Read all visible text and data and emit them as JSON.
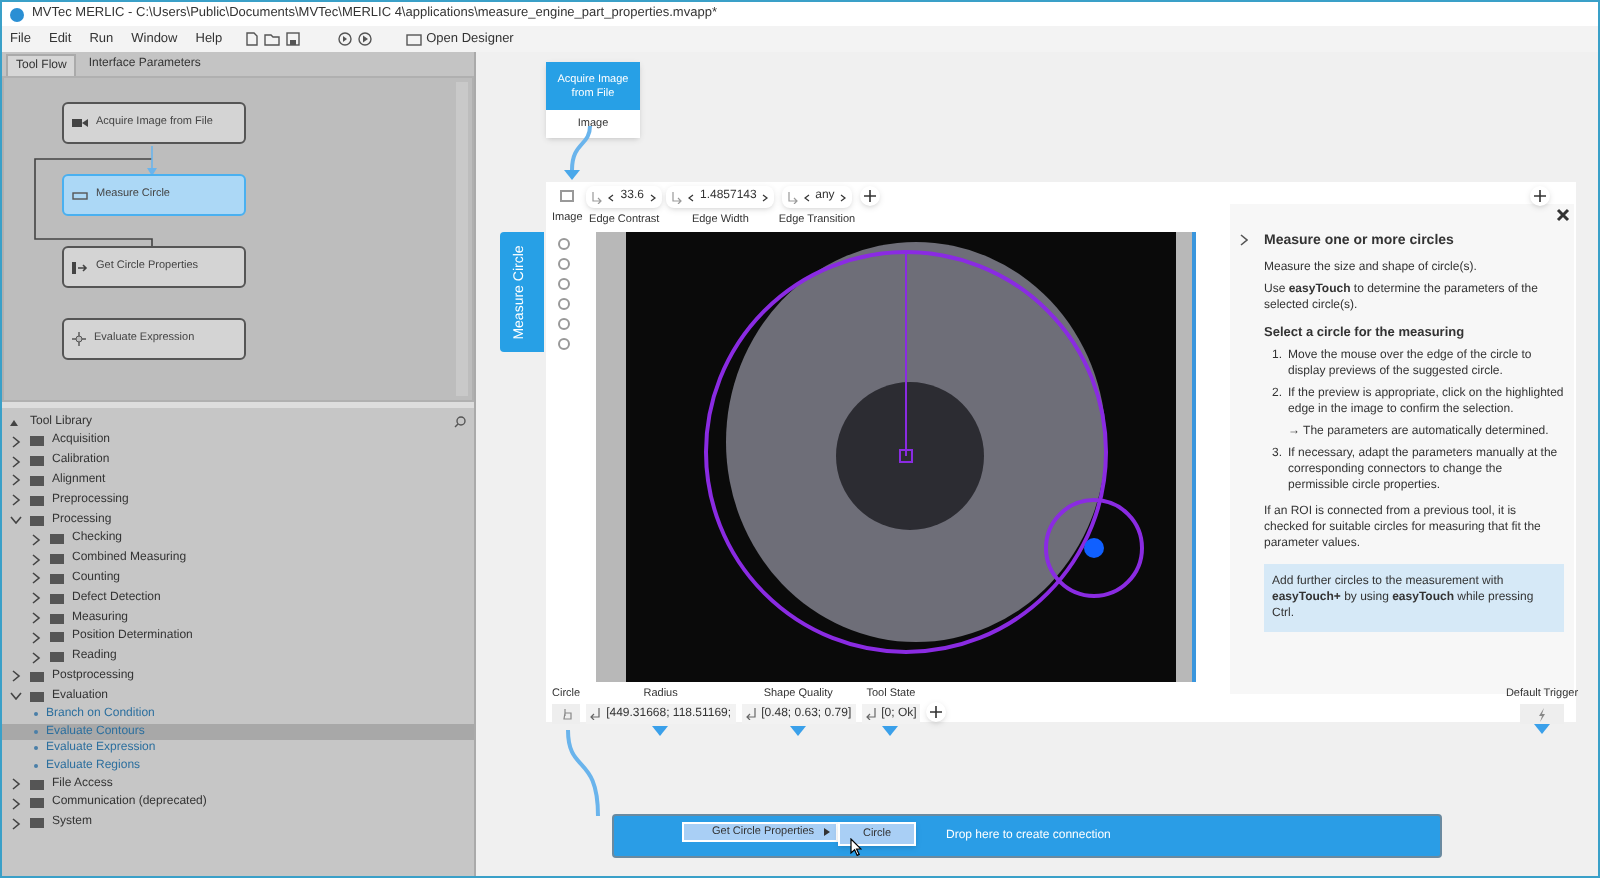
{
  "window": {
    "title": "MVTec MERLIC - C:\\Users\\Public\\Documents\\MVTec\\MERLIC 4\\applications\\measure_engine_part_properties.mvapp*"
  },
  "menu": [
    "File",
    "Edit",
    "Run",
    "Window",
    "Help"
  ],
  "toolbar": {
    "designer": "Open Designer"
  },
  "left_tabs": [
    {
      "label": "Tool Flow",
      "selected": true
    },
    {
      "label": "Interface Parameters",
      "selected": false
    }
  ],
  "flow_nodes": [
    {
      "label": "Acquire Image from File",
      "kind": "camera",
      "selected": false
    },
    {
      "label": "Measure Circle",
      "kind": "measure",
      "selected": true
    },
    {
      "label": "Get Circle Properties",
      "kind": "post",
      "selected": false
    },
    {
      "label": "Evaluate Expression",
      "kind": "eval",
      "selected": false
    }
  ],
  "tool_library": {
    "title": "Tool Library",
    "items": [
      {
        "label": "Acquisition",
        "expanded": false
      },
      {
        "label": "Calibration",
        "expanded": false
      },
      {
        "label": "Alignment",
        "expanded": false
      },
      {
        "label": "Preprocessing",
        "expanded": false
      },
      {
        "label": "Processing",
        "expanded": true,
        "children": [
          {
            "label": "Checking",
            "expanded": false
          },
          {
            "label": "Combined Measuring",
            "expanded": false
          },
          {
            "label": "Counting",
            "expanded": false
          },
          {
            "label": "Defect Detection",
            "expanded": false
          },
          {
            "label": "Measuring",
            "expanded": false
          },
          {
            "label": "Position Determination",
            "expanded": false
          },
          {
            "label": "Reading",
            "expanded": false
          }
        ]
      },
      {
        "label": "Postprocessing",
        "expanded": false
      },
      {
        "label": "Evaluation",
        "expanded": true,
        "children": [
          {
            "label": "Branch on Condition",
            "selected": false
          },
          {
            "label": "Evaluate Contours",
            "selected": true
          },
          {
            "label": "Evaluate Expression",
            "selected": false
          },
          {
            "label": "Evaluate Regions",
            "selected": false
          }
        ]
      },
      {
        "label": "File Access",
        "expanded": false
      },
      {
        "label": "Communication (deprecated)",
        "expanded": false
      },
      {
        "label": "System",
        "expanded": false
      }
    ]
  },
  "source_node": {
    "title": "Acquire Image from File",
    "output": "Image"
  },
  "tool": {
    "name": "Measure Circle",
    "inputs": [
      {
        "kind": "image",
        "label": "Image"
      },
      {
        "kind": "param",
        "label": "Edge Contrast",
        "value": "33.6"
      },
      {
        "kind": "param",
        "label": "Edge Width",
        "value": "1.4857143"
      },
      {
        "kind": "param",
        "label": "Edge Transition",
        "value": "any"
      }
    ],
    "outputs": [
      {
        "kind": "circle",
        "label": "Circle"
      },
      {
        "kind": "value",
        "label": "Radius",
        "value": "[449.31668; 118.51169;"
      },
      {
        "kind": "value",
        "label": "Shape Quality",
        "value": "[0.48; 0.63; 0.79]"
      },
      {
        "kind": "value",
        "label": "Tool State",
        "value": "[0; Ok]"
      }
    ],
    "trigger": "Default Trigger"
  },
  "help": {
    "title": "Measure one or more circles",
    "paragraphs": [
      "Measure the size and shape of circle(s).",
      "Use **easyTouch** to determine the parameters of the selected circle(s)."
    ],
    "subtitle": "Select a circle for the measuring",
    "steps": [
      {
        "number": "1.",
        "text": "Move the mouse over the edge of the circle to display previews of the suggested circle."
      },
      {
        "number": "2.",
        "text": "If the preview is appropriate, click on the highlighted edge in the image to confirm the selection."
      },
      {
        "number": "3.",
        "text": "If necessary, adapt the parameters manually at the corresponding connectors to change the permissible circle properties."
      }
    ],
    "result": "→ The parameters are automatically determined.",
    "note": "If an ROI is connected from a previous tool, it is checked for suitable circles for measuring that fit the parameter values.",
    "tip": "Add further circles to the measurement with **easyTouch+** by using **easyTouch** while pressing Ctrl."
  },
  "drop_bar": {
    "text": "Drop here to create connection",
    "menu_item": "Get Circle Properties",
    "submenu_item": "Circle"
  }
}
